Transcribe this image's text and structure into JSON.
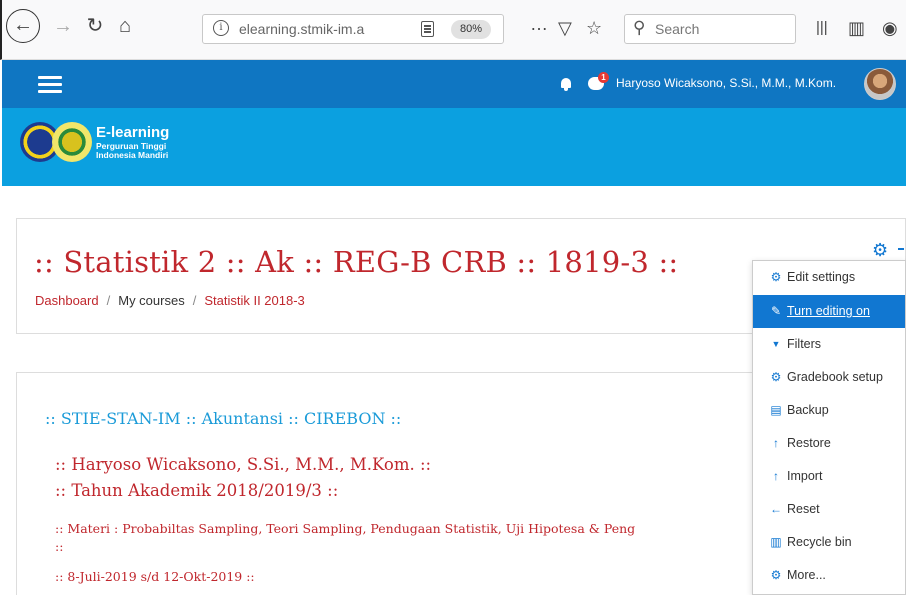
{
  "browser": {
    "url": "elearning.stmik-im.a",
    "zoom": "80%",
    "search_placeholder": "Search",
    "more_glyph": "…"
  },
  "navbar": {
    "user_name": "Haryoso Wicaksono, S.Si., M.M., M.Kom.",
    "chat_badge": "1"
  },
  "brand": {
    "title": "E-learning",
    "subtitle_line1": "Perguruan Tinggi",
    "subtitle_line2": "Indonesia Mandiri"
  },
  "header": {
    "course_title": ":: Statistik 2 :: Ak :: REG-B CRB :: 1819-3 ::",
    "breadcrumb": [
      {
        "label": "Dashboard",
        "link": true
      },
      {
        "label": "My courses",
        "link": false
      },
      {
        "label": "Statistik II 2018-3",
        "link": true
      }
    ]
  },
  "content": {
    "line_a": ":: STIE-STAN-IM :: Akuntansi :: CIREBON ::",
    "line_b": ":: Haryoso Wicaksono, S.Si., M.M., M.Kom. ::",
    "line_c": ":: Tahun Akademik 2018/2019/3 ::",
    "line_d": ":: Materi : Probabiltas Sampling, Teori Sampling, Pendugaan Statistik, Uji Hipotesa & Peng",
    "line_d2": "::",
    "line_e": ":: 8-Juli-2019 s/d 12-Okt-2019 ::"
  },
  "menu": {
    "items": [
      {
        "label": "Edit settings",
        "icon": "gear-icon",
        "glyph": "⚙"
      },
      {
        "label": "Turn editing on",
        "icon": "pencil-icon",
        "glyph": "✎"
      },
      {
        "label": "Filters",
        "icon": "filter-icon",
        "glyph": "▼"
      },
      {
        "label": "Gradebook setup",
        "icon": "gear-icon",
        "glyph": "⚙"
      },
      {
        "label": "Backup",
        "icon": "file-icon",
        "glyph": "▤"
      },
      {
        "label": "Restore",
        "icon": "upload-icon",
        "glyph": "↑"
      },
      {
        "label": "Import",
        "icon": "upload-icon",
        "glyph": "↑"
      },
      {
        "label": "Reset",
        "icon": "arrow-left-icon",
        "glyph": "←"
      },
      {
        "label": "Recycle bin",
        "icon": "trash-icon",
        "glyph": "▥"
      },
      {
        "label": "More...",
        "icon": "gear-icon",
        "glyph": "⚙"
      }
    ],
    "active_index": 1
  },
  "colors": {
    "navbar": "#0f76c2",
    "banner": "#0ba0e0",
    "title_red": "#c0272d",
    "accent_blue": "#1177d1",
    "link_blue": "#1b9bd8"
  }
}
